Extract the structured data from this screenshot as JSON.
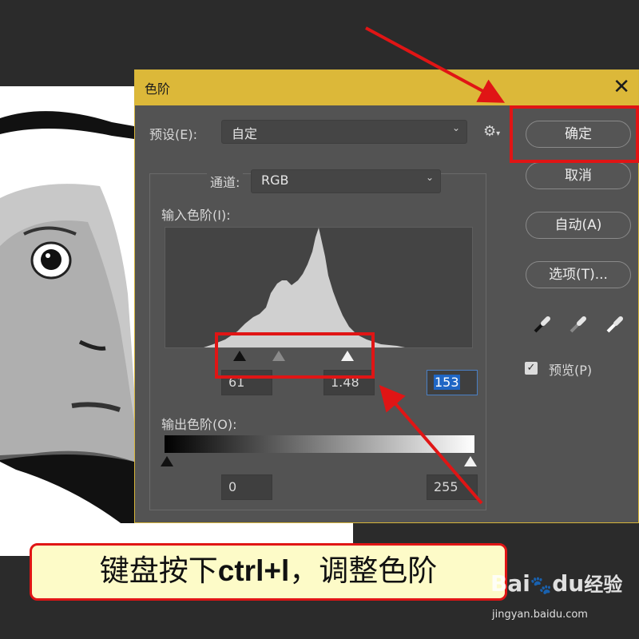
{
  "dialog": {
    "title": "色阶",
    "close_glyph": "✕",
    "preset_label": "预设(E):",
    "preset_value": "自定",
    "channel_label": "通道:",
    "channel_value": "RGB",
    "input_levels_label": "输入色阶(I):",
    "input_black": "61",
    "input_gamma": "1.48",
    "input_white": "153",
    "output_levels_label": "输出色阶(O):",
    "output_black": "0",
    "output_white": "255",
    "buttons": {
      "ok": "确定",
      "cancel": "取消",
      "auto": "自动(A)",
      "options": "选项(T)..."
    },
    "preview_label": "预览(P)",
    "preview_checked": true,
    "title_bar_color": "#dcb839"
  },
  "annotation": {
    "caption": "键盘按下",
    "caption_bold": "ctrl+l",
    "caption_tail": "，调整色阶",
    "highlight_color": "#e01515"
  },
  "watermark": {
    "brand": "Bai",
    "brand2": "du",
    "brand_cn": "经验",
    "url": "jingyan.baidu.com"
  },
  "icons": [
    "gear-icon",
    "chevron-down-icon",
    "eyedropper-black-icon",
    "eyedropper-gray-icon",
    "eyedropper-white-icon",
    "checkbox-icon",
    "paw-icon"
  ]
}
